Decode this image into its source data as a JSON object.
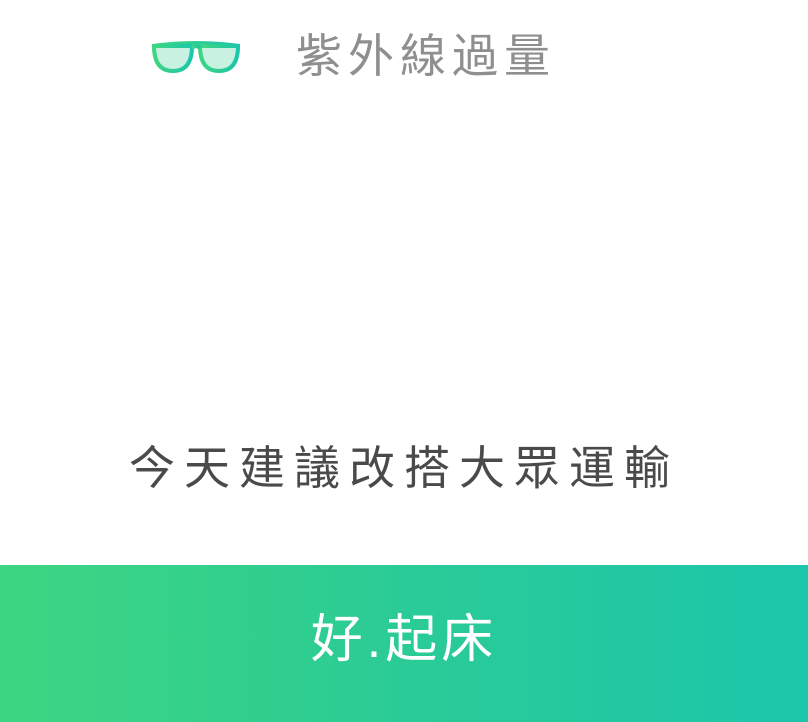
{
  "header": {
    "icon": "glasses-icon",
    "title": "紫外線過量"
  },
  "advice": {
    "text": "今天建議改搭大眾運輸"
  },
  "action": {
    "label": "好.起床"
  },
  "colors": {
    "accent_start": "#3dd681",
    "accent_end": "#1cc6aa",
    "title_gray": "#8f8f8f",
    "text_dark": "#4a4a4a"
  }
}
